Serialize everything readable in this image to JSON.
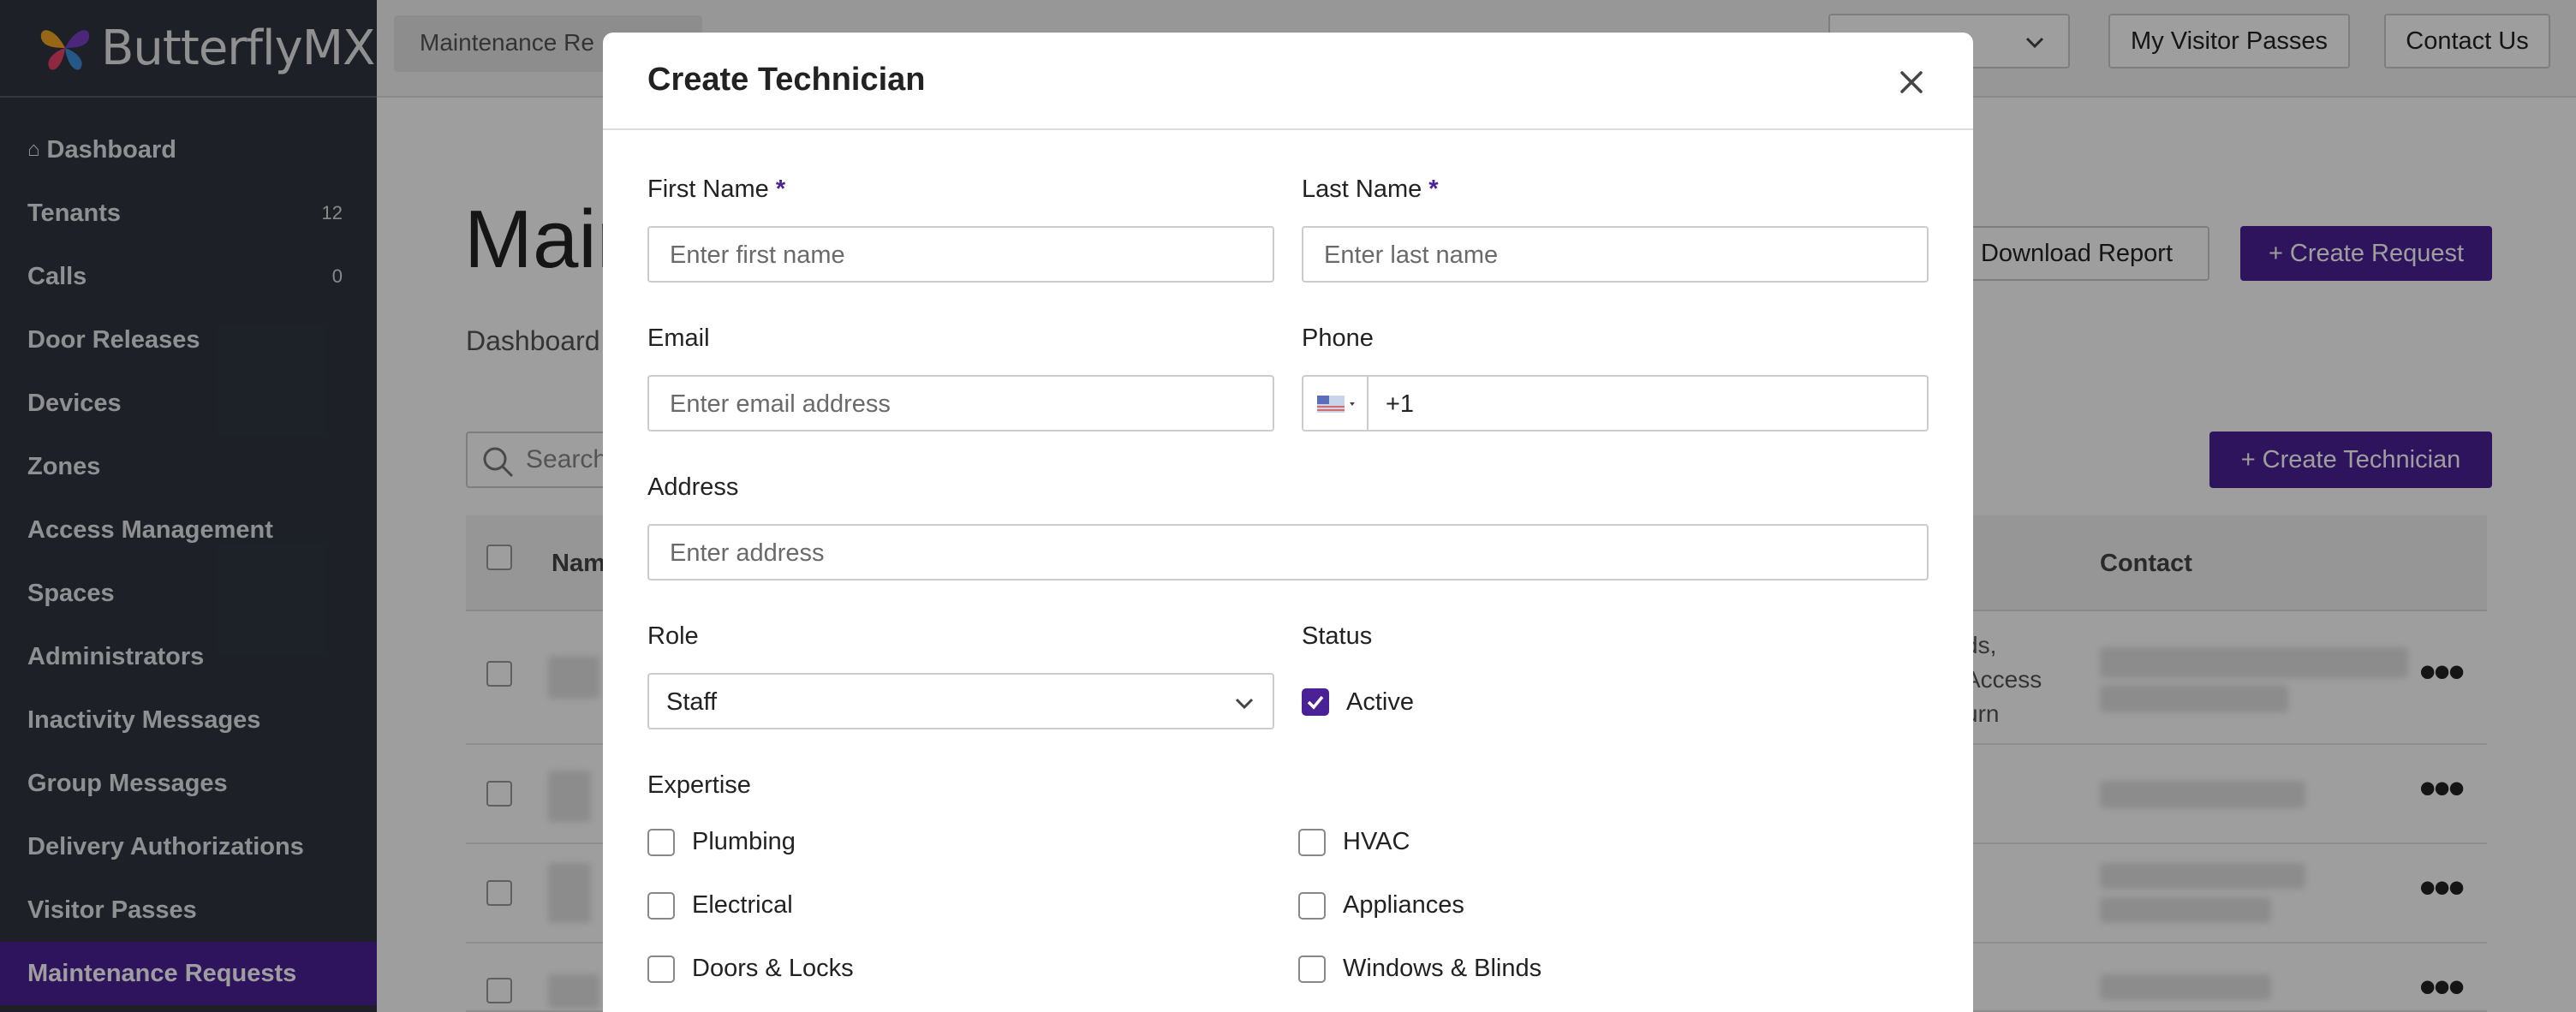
{
  "colors": {
    "brand": "#4b2196",
    "sidebar": "#2f3640"
  },
  "sidebar": {
    "brand": "ButterflyMX",
    "items": [
      {
        "label": "Dashboard",
        "count": "",
        "icon": "home-icon"
      },
      {
        "label": "Tenants",
        "count": "12"
      },
      {
        "label": "Calls",
        "count": "0"
      },
      {
        "label": "Door Releases",
        "count": ""
      },
      {
        "label": "Devices",
        "count": ""
      },
      {
        "label": "Zones",
        "count": ""
      },
      {
        "label": "Access Management",
        "count": ""
      },
      {
        "label": "Spaces",
        "count": ""
      },
      {
        "label": "Administrators",
        "count": ""
      },
      {
        "label": "Inactivity Messages",
        "count": ""
      },
      {
        "label": "Group Messages",
        "count": ""
      },
      {
        "label": "Delivery Authorizations",
        "count": ""
      },
      {
        "label": "Visitor Passes",
        "count": ""
      },
      {
        "label": "Maintenance Requests",
        "count": "",
        "active": true
      }
    ]
  },
  "topbar": {
    "crumb_tab": "Maintenance Re",
    "my_visitor_passes": "My Visitor Passes",
    "contact_us": "Contact Us"
  },
  "page": {
    "title": "Main",
    "breadcrumb": "Dashboard",
    "download_report": "Download Report",
    "create_request": "+ Create Request",
    "search_placeholder": "Search",
    "create_technician": "+ Create Technician",
    "table": {
      "col_name": "Nam",
      "col_contact": "Contact",
      "row1_text": [
        "ds,",
        "Access",
        "urn"
      ]
    }
  },
  "modal": {
    "title": "Create Technician",
    "first_name_label": "First Name",
    "first_name_placeholder": "Enter first name",
    "last_name_label": "Last Name",
    "last_name_placeholder": "Enter last name",
    "required_mark": "*",
    "email_label": "Email",
    "email_placeholder": "Enter email address",
    "phone_label": "Phone",
    "phone_value": "+1",
    "address_label": "Address",
    "address_placeholder": "Enter address",
    "role_label": "Role",
    "role_value": "Staff",
    "status_label": "Status",
    "status_active_label": "Active",
    "status_active_checked": true,
    "expertise_label": "Expertise",
    "expertise": [
      {
        "label": "Plumbing",
        "checked": false
      },
      {
        "label": "HVAC",
        "checked": false
      },
      {
        "label": "Electrical",
        "checked": false
      },
      {
        "label": "Appliances",
        "checked": false
      },
      {
        "label": "Doors & Locks",
        "checked": false
      },
      {
        "label": "Windows & Blinds",
        "checked": false
      }
    ]
  }
}
